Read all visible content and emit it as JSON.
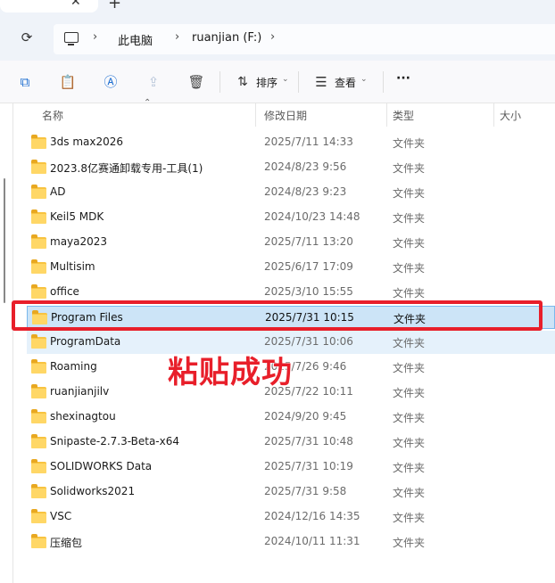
{
  "tabs": {
    "close_glyph": "✕",
    "new_glyph": "+"
  },
  "address": {
    "refresh_icon": "refresh-icon",
    "crumbs": [
      "此电脑",
      "ruanjian (F:)"
    ],
    "separator": "›"
  },
  "toolbar": {
    "sort_label": "排序",
    "view_label": "查看",
    "more_label": "···"
  },
  "columns": {
    "name": "名称",
    "modified": "修改日期",
    "type": "类型",
    "size": "大小"
  },
  "rows": [
    {
      "name": "3ds max2026",
      "date": "2025/7/11 14:33",
      "type": "文件夹"
    },
    {
      "name": "2023.8亿赛通卸载专用-工具(1)",
      "date": "2024/8/23 9:56",
      "type": "文件夹"
    },
    {
      "name": "AD",
      "date": "2024/8/23 9:23",
      "type": "文件夹"
    },
    {
      "name": "Keil5 MDK",
      "date": "2024/10/23 14:48",
      "type": "文件夹"
    },
    {
      "name": "maya2023",
      "date": "2025/7/11 13:20",
      "type": "文件夹"
    },
    {
      "name": "Multisim",
      "date": "2025/6/17 17:09",
      "type": "文件夹"
    },
    {
      "name": "office",
      "date": "2025/3/10 15:55",
      "type": "文件夹"
    },
    {
      "name": "Program Files",
      "date": "2025/7/31 10:15",
      "type": "文件夹"
    },
    {
      "name": "ProgramData",
      "date": "2025/7/31 10:06",
      "type": "文件夹"
    },
    {
      "name": "Roaming",
      "date": "2025/7/26 9:46",
      "type": "文件夹"
    },
    {
      "name": "ruanjianjilv",
      "date": "2025/7/22 10:11",
      "type": "文件夹"
    },
    {
      "name": "shexinagtou",
      "date": "2024/9/20 9:45",
      "type": "文件夹"
    },
    {
      "name": "Snipaste-2.7.3-Beta-x64",
      "date": "2025/7/31 10:48",
      "type": "文件夹"
    },
    {
      "name": "SOLIDWORKS Data",
      "date": "2025/7/31 10:19",
      "type": "文件夹"
    },
    {
      "name": "Solidworks2021",
      "date": "2025/7/31 9:58",
      "type": "文件夹"
    },
    {
      "name": "VSC",
      "date": "2024/12/16 14:35",
      "type": "文件夹"
    },
    {
      "name": "压缩包",
      "date": "2024/10/11 11:31",
      "type": "文件夹"
    }
  ],
  "annotation": {
    "text": "粘贴成功",
    "color": "#e81f2a"
  },
  "colors": {
    "selected_bg": "#cce4f7",
    "hover_bg": "#e5f1fb",
    "folder": "#ffd766"
  }
}
